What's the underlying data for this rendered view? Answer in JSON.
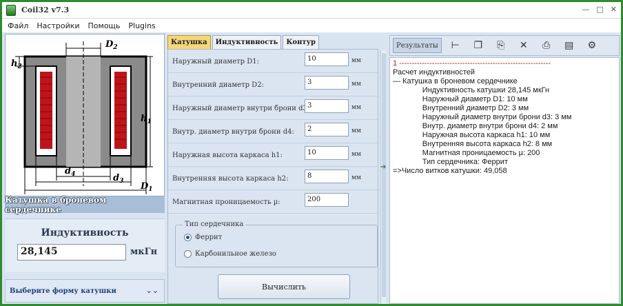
{
  "window": {
    "title": "Coil32 v7.3",
    "minimize": "—",
    "maximize": "□",
    "close": "✕"
  },
  "menu": [
    "Файл",
    "Настройки",
    "Помощь",
    "Plugins"
  ],
  "left": {
    "diagram_labels": {
      "D2": "D",
      "D2_sub": "2",
      "h2": "h",
      "h2_sub": "2",
      "h1": "h",
      "h1_sub": "1",
      "d4": "d",
      "d4_sub": "4",
      "d3": "d",
      "d3_sub": "3",
      "D1": "D",
      "D1_sub": "1"
    },
    "caption": "Катушка в броневом сердечнике",
    "inductance_title": "Индуктивность",
    "inductance_value": "28,145",
    "inductance_unit": "мкГн",
    "shape_selector": "Выберите форму катушки",
    "chevron_icon": "double-chevron-down-icon"
  },
  "middle": {
    "tabs": [
      {
        "label": "Катушка",
        "active": true
      },
      {
        "label": "Индуктивность",
        "active": false
      },
      {
        "label": "Контур",
        "active": false
      }
    ],
    "fields": [
      {
        "label": "Наружный диаметр D1:",
        "value": "10",
        "unit": "мм"
      },
      {
        "label": "Внутренний диаметр D2:",
        "value": "3",
        "unit": "мм"
      },
      {
        "label": "Наружный диаметр внутри брони d3:",
        "value": "3",
        "unit": "мм"
      },
      {
        "label": "Внутр. диаметр внутри брони d4:",
        "value": "2",
        "unit": "мм"
      },
      {
        "label": "Наружная высота каркаса h1:",
        "value": "10",
        "unit": "мм"
      },
      {
        "label": "Внутренняя высота каркаса h2:",
        "value": "8",
        "unit": "мм"
      },
      {
        "label": "Магнитная проницаемость µ:",
        "value": "200",
        "unit": ""
      }
    ],
    "core_type": {
      "legend": "Тип сердечника",
      "options": [
        {
          "label": "Феррит",
          "selected": true
        },
        {
          "label": "Карбонильное железо",
          "selected": false
        }
      ]
    },
    "calculate_label": "Вычислить"
  },
  "right": {
    "results_tab": "Результаты",
    "toolbar_icons": [
      "tree-icon",
      "copy-icon",
      "paste-icon",
      "clear-icon",
      "print-icon",
      "table-icon",
      "settings-icon"
    ],
    "output": [
      {
        "text": "1 ------------------------------------------------------------",
        "style": "red"
      },
      {
        "text": "Расчет индуктивностей",
        "style": ""
      },
      {
        "text": "— Катушка в броневом сердечнике",
        "style": ""
      },
      {
        "text": "              Индуктивность катушки 28,145 мкГн",
        "style": ""
      },
      {
        "text": "              Наружный диаметр D1: 10 мм",
        "style": ""
      },
      {
        "text": "              Внутренний диаметр D2: 3 мм",
        "style": ""
      },
      {
        "text": "              Наружный диаметр внутри брони d3: 3 мм",
        "style": ""
      },
      {
        "text": "              Внутр. диаметр внутри брони d4: 2 мм",
        "style": ""
      },
      {
        "text": "              Наружная высота каркаса h1: 10 мм",
        "style": ""
      },
      {
        "text": "              Внутренняя высота каркаса h2: 8 мм",
        "style": ""
      },
      {
        "text": "              Магнитная проницаемость µ: 200",
        "style": ""
      },
      {
        "text": "              Тип сердечника: Феррит",
        "style": ""
      },
      {
        "text": "=>Число витков катушки: 49,058",
        "style": ""
      }
    ]
  }
}
